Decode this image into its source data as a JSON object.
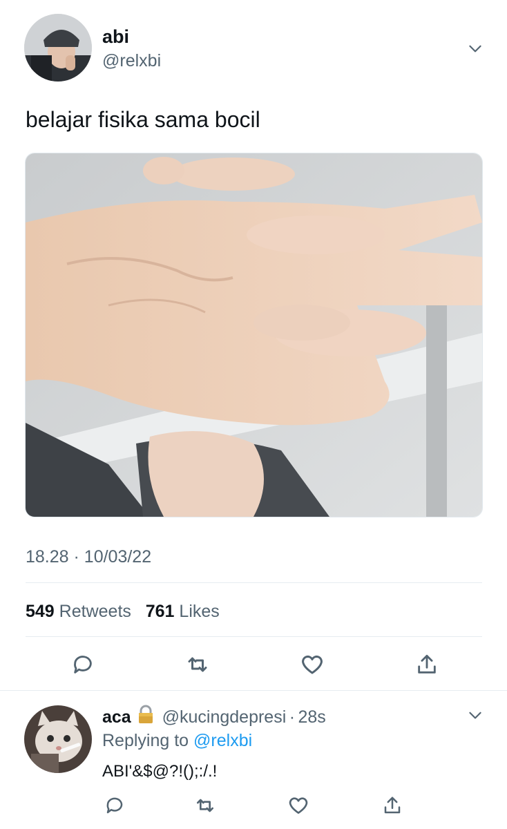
{
  "tweet": {
    "author_name": "abi",
    "author_handle": "@relxbi",
    "text": "belajar fisika sama bocil",
    "time": "18.28",
    "date": "10/03/22",
    "time_sep": "·",
    "retweets_count": "549",
    "retweets_label": "Retweets",
    "likes_count": "761",
    "likes_label": "Likes"
  },
  "reply": {
    "author_name": "aca",
    "author_handle": "@kucingdepresi",
    "time_sep": "·",
    "age": "28s",
    "replying_prefix": "Replying to",
    "replying_to": "@relxbi",
    "text": "ABI'&$@?!();:/.!"
  },
  "icons": {
    "menu": "chevron-down-icon",
    "reply": "reply-icon",
    "retweet": "retweet-icon",
    "like": "heart-icon",
    "share": "share-icon",
    "lock": "lock-icon"
  },
  "colors": {
    "text": "#0f1419",
    "secondary": "#536471",
    "link": "#1d9bf0",
    "divider": "#e6ecf0"
  }
}
